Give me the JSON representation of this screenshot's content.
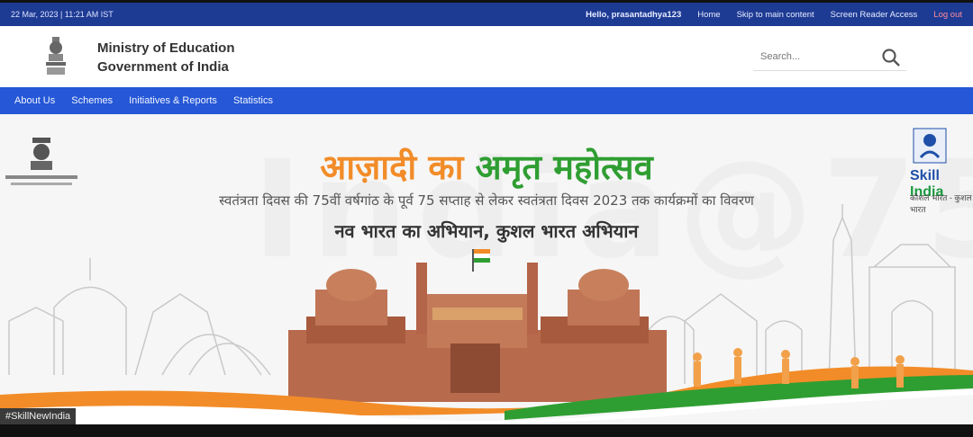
{
  "topbar": {
    "datetime": "22 Mar, 2023 | 11:21 AM IST",
    "hello": "Hello, prasantadhya123",
    "home": "Home",
    "skip": "Skip to main content",
    "screen_reader": "Screen Reader Access",
    "logout": "Log out"
  },
  "header": {
    "ministry_line1": "Ministry of Education",
    "ministry_line2": "Government of India",
    "search_placeholder": "Search...",
    "emblem_icon": "national-emblem-icon",
    "search_icon": "search-icon"
  },
  "nav": {
    "items": [
      "About Us",
      "Schemes",
      "Initiatives & Reports",
      "Statistics"
    ]
  },
  "banner": {
    "title_part1": "आज़ादी का",
    "title_part2": "अमृत महोत्सव",
    "subtitle": "स्वतंत्रता दिवस की 75वीं वर्षगांठ के पूर्व 75 सप्ताह से लेकर स्वतंत्रता दिवस 2023 तक कार्यक्रमों का विवरण",
    "tagline": "नव भारत का अभियान, कुशल भारत अभियान",
    "watermark": "India@75",
    "skill_india_1": "Skill",
    "skill_india_2": "India",
    "skill_tagline": "कौशल भारत - कुशल भारत",
    "hashtag": "#SkillNewIndia",
    "colors": {
      "orange": "#f28c28",
      "green": "#2f9e32",
      "fort": "#b86a4c"
    }
  },
  "colors": {
    "topbar": "#1e3b94",
    "navbar": "#2557d6"
  }
}
